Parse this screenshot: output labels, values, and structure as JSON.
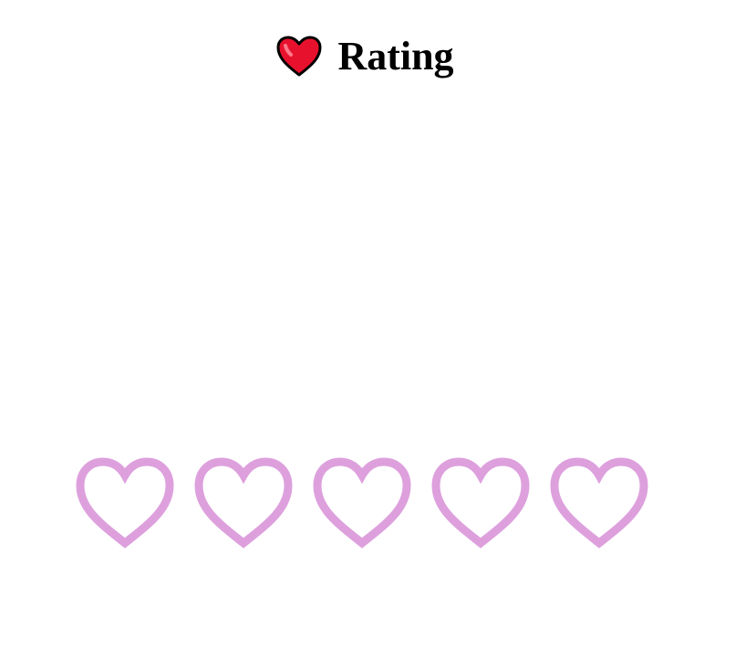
{
  "header": {
    "icon": "red-heart-icon",
    "title": "Rating"
  },
  "rating": {
    "value": 0,
    "max": 5,
    "icon": "heart-outline-icon",
    "outline_color": "#DDA0DD",
    "fill_color": "#DDA0DD"
  },
  "colors": {
    "background": "#ffffff",
    "title_text": "#000000",
    "heart_emoji": "#E8112D"
  }
}
